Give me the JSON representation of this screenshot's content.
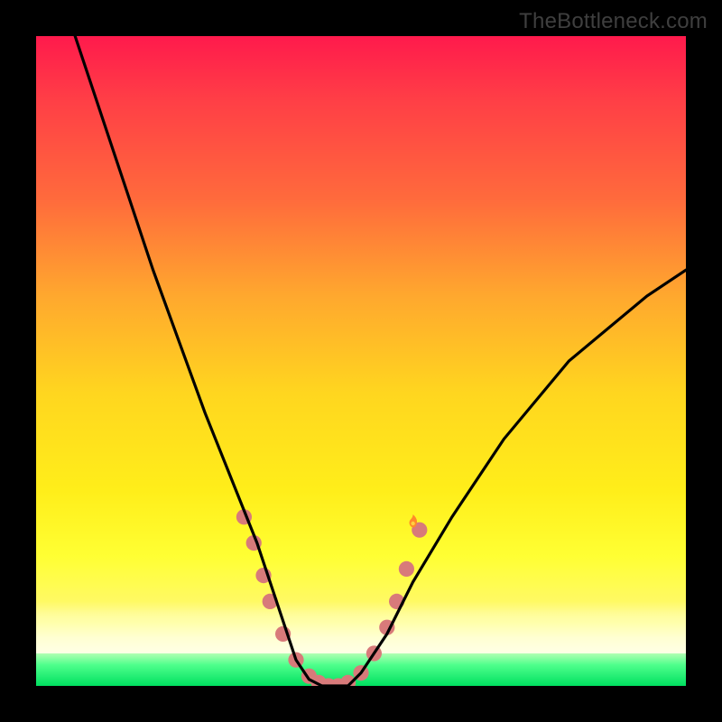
{
  "watermark": {
    "text": "TheBottleneck.com"
  },
  "chart_data": {
    "type": "line",
    "title": "",
    "xlabel": "",
    "ylabel": "",
    "xlim": [
      0,
      100
    ],
    "ylim": [
      0,
      100
    ],
    "grid": false,
    "legend": false,
    "background_gradient": {
      "direction": "vertical",
      "stops": [
        {
          "pos": 0,
          "color": "#ff1a4c"
        },
        {
          "pos": 25,
          "color": "#ff6a3c"
        },
        {
          "pos": 55,
          "color": "#ffd61f"
        },
        {
          "pos": 80,
          "color": "#ffff33"
        },
        {
          "pos": 92,
          "color": "#fffcbb"
        },
        {
          "pos": 100,
          "color": "#00e060"
        }
      ]
    },
    "series": [
      {
        "name": "bottleneck-curve",
        "color": "#000000",
        "x": [
          6,
          10,
          14,
          18,
          22,
          26,
          30,
          34,
          36,
          38,
          40,
          42,
          44,
          46,
          48,
          50,
          54,
          58,
          64,
          72,
          82,
          94,
          100
        ],
        "y": [
          100,
          88,
          76,
          64,
          53,
          42,
          32,
          22,
          16,
          10,
          4,
          1,
          0,
          0,
          0,
          2,
          8,
          16,
          26,
          38,
          50,
          60,
          64
        ]
      }
    ],
    "markers": {
      "name": "highlight-dots",
      "color": "#d87a7a",
      "radius_pct": 1.2,
      "points": [
        {
          "x": 32,
          "y": 26
        },
        {
          "x": 33.5,
          "y": 22
        },
        {
          "x": 35,
          "y": 17
        },
        {
          "x": 36,
          "y": 13
        },
        {
          "x": 38,
          "y": 8
        },
        {
          "x": 40,
          "y": 4
        },
        {
          "x": 42,
          "y": 1.5
        },
        {
          "x": 43.5,
          "y": 0.5
        },
        {
          "x": 45,
          "y": 0
        },
        {
          "x": 46.5,
          "y": 0
        },
        {
          "x": 48,
          "y": 0.5
        },
        {
          "x": 50,
          "y": 2
        },
        {
          "x": 52,
          "y": 5
        },
        {
          "x": 54,
          "y": 9
        },
        {
          "x": 55.5,
          "y": 13
        },
        {
          "x": 57,
          "y": 18
        },
        {
          "x": 59,
          "y": 24
        }
      ]
    },
    "flame_marker": {
      "x": 58,
      "y": 25,
      "color": "#ff8a2a"
    }
  }
}
